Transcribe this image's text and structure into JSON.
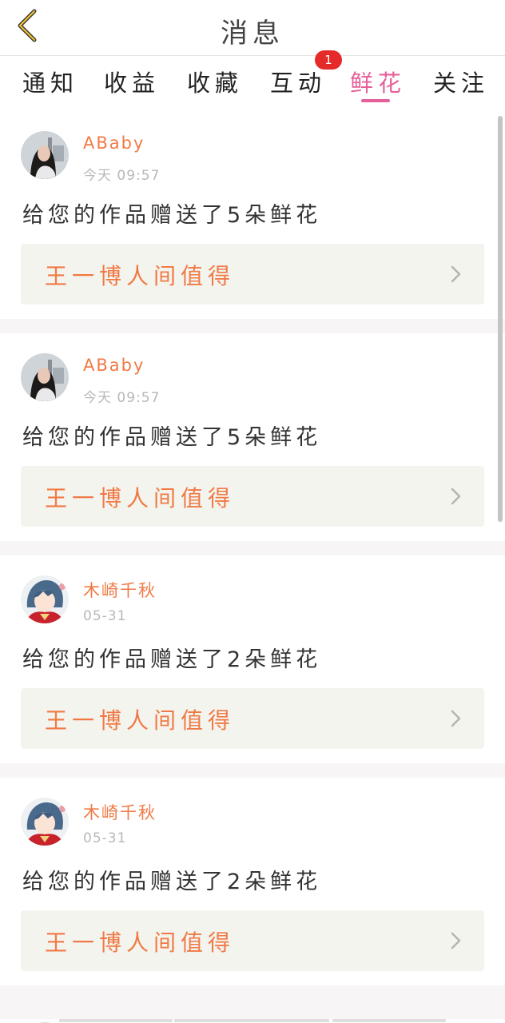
{
  "header": {
    "title": "消息",
    "back_icon": "chevron-left-icon"
  },
  "tabs": [
    {
      "label": "通知"
    },
    {
      "label": "收益"
    },
    {
      "label": "收藏"
    },
    {
      "label": "互动",
      "badge": "1"
    },
    {
      "label": "鲜花",
      "active": true
    },
    {
      "label": "关注"
    }
  ],
  "colors": {
    "accent": "#e5609a",
    "username": "#f07a45",
    "badge": "#e52a2a",
    "link_bg": "#f4f4ef"
  },
  "messages": [
    {
      "avatar": "avatar-photo-girl",
      "username": "ABaby",
      "time": "今天 09:57",
      "text": "给您的作品赠送了5朵鲜花",
      "work": "王一博人间值得"
    },
    {
      "avatar": "avatar-photo-girl",
      "username": "ABaby",
      "time": "今天 09:57",
      "text": "给您的作品赠送了5朵鲜花",
      "work": "王一博人间值得"
    },
    {
      "avatar": "avatar-anime",
      "username": "木崎千秋",
      "time": "05-31",
      "text": "给您的作品赠送了2朵鲜花",
      "work": "王一博人间值得"
    },
    {
      "avatar": "avatar-anime",
      "username": "木崎千秋",
      "time": "05-31",
      "text": "给您的作品赠送了2朵鲜花",
      "work": "王一博人间值得"
    }
  ]
}
